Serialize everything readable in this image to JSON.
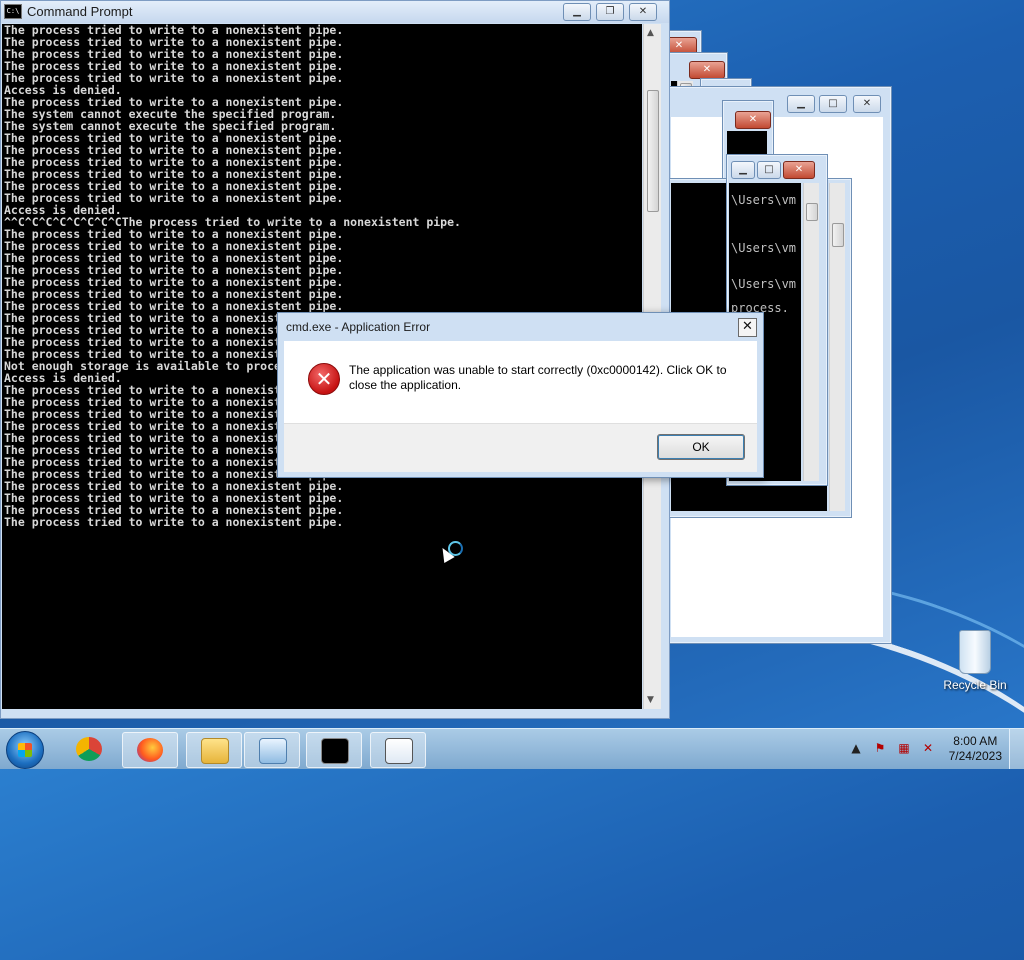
{
  "main_window": {
    "title": "Command Prompt",
    "buttons": {
      "minimize": "▁",
      "maximize": "❐",
      "close": "✕"
    },
    "console_lines": [
      "The process tried to write to a nonexistent pipe.",
      "The process tried to write to a nonexistent pipe.",
      "The process tried to write to a nonexistent pipe.",
      "The process tried to write to a nonexistent pipe.",
      "The process tried to write to a nonexistent pipe.",
      "Access is denied.",
      "The process tried to write to a nonexistent pipe.",
      "The system cannot execute the specified program.",
      "The system cannot execute the specified program.",
      "The process tried to write to a nonexistent pipe.",
      "The process tried to write to a nonexistent pipe.",
      "The process tried to write to a nonexistent pipe.",
      "The process tried to write to a nonexistent pipe.",
      "The process tried to write to a nonexistent pipe.",
      "The process tried to write to a nonexistent pipe.",
      "Access is denied.",
      "^^C^C^C^C^C^C^C^CThe process tried to write to a nonexistent pipe.",
      "The process tried to write to a nonexistent pipe.",
      "The process tried to write to a nonexistent pipe.",
      "The process tried to write to a nonexistent pipe.",
      "The process tried to write to a nonexistent pipe.",
      "The process tried to write to a nonexistent pipe.",
      "The process tried to write to a nonexistent pipe.",
      "The process tried to write to a nonexistent pipe.",
      "The process tried to write to a nonexistent pipe.",
      "The process tried to write to a nonexistent pipe.",
      "The process tried to write to a nonexistent pipe.",
      "The process tried to write to a nonexistent pipe.",
      "Not enough storage is available to process this command.",
      "Access is denied.",
      "The process tried to write to a nonexistent pipe.",
      "The process tried to write to a nonexistent pipe.",
      "The process tried to write to a nonexistent pipe.",
      "The process tried to write to a nonexistent pipe.",
      "The process tried to write to a nonexistent pipe.",
      "The process tried to write to a nonexistent pipe.",
      "The process tried to write to a nonexistent pipe.",
      "The process tried to write to a nonexistent pipe.",
      "The process tried to write to a nonexistent pipe.",
      "The process tried to write to a nonexistent pipe.",
      "The process tried to write to a nonexistent pipe.",
      "The process tried to write to a nonexistent pipe."
    ]
  },
  "background_windows": {
    "fragments": [
      "\\Users\\vm",
      "\\Users\\vm",
      "\\Users\\vm",
      "process."
    ]
  },
  "dialog": {
    "title": "cmd.exe - Application Error",
    "close_label": "✕",
    "message": "The application was unable to start correctly (0xc0000142). Click OK to close the application.",
    "ok_label": "OK",
    "icon": "error-icon"
  },
  "desktop": {
    "recycle_bin_label": "Recycle Bin"
  },
  "taskbar": {
    "pinned": [
      "start-orb",
      "chrome-icon",
      "firefox-icon",
      "explorer-icon",
      "control-panel-icon",
      "cmd-icon",
      "app-window-icon"
    ],
    "time": "8:00 AM",
    "date": "7/24/2023",
    "accent": "#1d6fc0"
  }
}
